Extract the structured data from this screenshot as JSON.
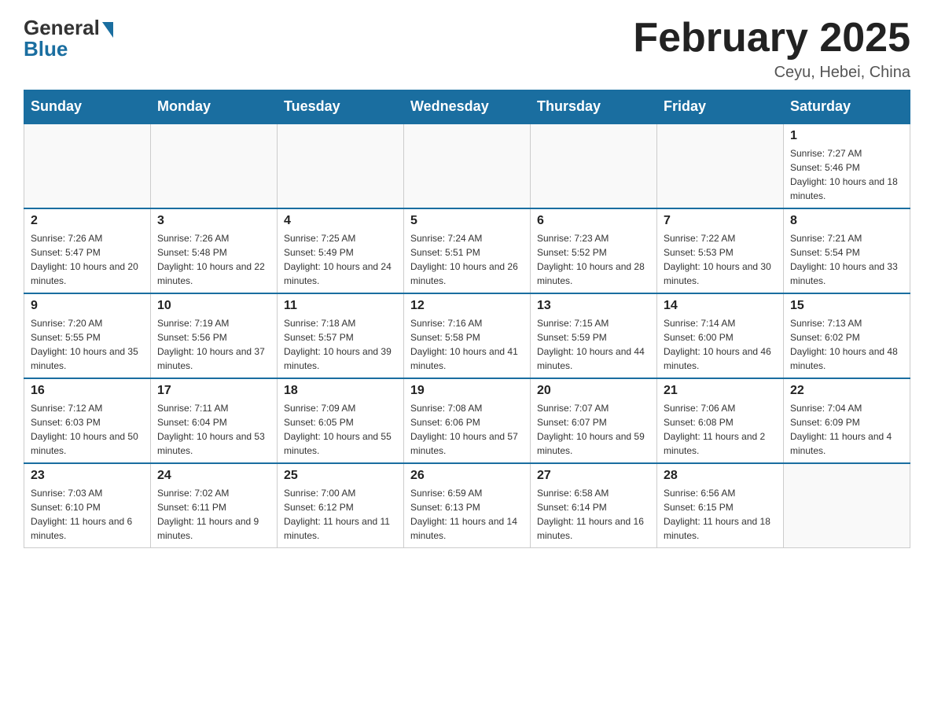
{
  "logo": {
    "general": "General",
    "blue": "Blue"
  },
  "header": {
    "month_title": "February 2025",
    "location": "Ceyu, Hebei, China"
  },
  "days_of_week": [
    "Sunday",
    "Monday",
    "Tuesday",
    "Wednesday",
    "Thursday",
    "Friday",
    "Saturday"
  ],
  "weeks": [
    [
      {
        "day": "",
        "info": ""
      },
      {
        "day": "",
        "info": ""
      },
      {
        "day": "",
        "info": ""
      },
      {
        "day": "",
        "info": ""
      },
      {
        "day": "",
        "info": ""
      },
      {
        "day": "",
        "info": ""
      },
      {
        "day": "1",
        "info": "Sunrise: 7:27 AM\nSunset: 5:46 PM\nDaylight: 10 hours and 18 minutes."
      }
    ],
    [
      {
        "day": "2",
        "info": "Sunrise: 7:26 AM\nSunset: 5:47 PM\nDaylight: 10 hours and 20 minutes."
      },
      {
        "day": "3",
        "info": "Sunrise: 7:26 AM\nSunset: 5:48 PM\nDaylight: 10 hours and 22 minutes."
      },
      {
        "day": "4",
        "info": "Sunrise: 7:25 AM\nSunset: 5:49 PM\nDaylight: 10 hours and 24 minutes."
      },
      {
        "day": "5",
        "info": "Sunrise: 7:24 AM\nSunset: 5:51 PM\nDaylight: 10 hours and 26 minutes."
      },
      {
        "day": "6",
        "info": "Sunrise: 7:23 AM\nSunset: 5:52 PM\nDaylight: 10 hours and 28 minutes."
      },
      {
        "day": "7",
        "info": "Sunrise: 7:22 AM\nSunset: 5:53 PM\nDaylight: 10 hours and 30 minutes."
      },
      {
        "day": "8",
        "info": "Sunrise: 7:21 AM\nSunset: 5:54 PM\nDaylight: 10 hours and 33 minutes."
      }
    ],
    [
      {
        "day": "9",
        "info": "Sunrise: 7:20 AM\nSunset: 5:55 PM\nDaylight: 10 hours and 35 minutes."
      },
      {
        "day": "10",
        "info": "Sunrise: 7:19 AM\nSunset: 5:56 PM\nDaylight: 10 hours and 37 minutes."
      },
      {
        "day": "11",
        "info": "Sunrise: 7:18 AM\nSunset: 5:57 PM\nDaylight: 10 hours and 39 minutes."
      },
      {
        "day": "12",
        "info": "Sunrise: 7:16 AM\nSunset: 5:58 PM\nDaylight: 10 hours and 41 minutes."
      },
      {
        "day": "13",
        "info": "Sunrise: 7:15 AM\nSunset: 5:59 PM\nDaylight: 10 hours and 44 minutes."
      },
      {
        "day": "14",
        "info": "Sunrise: 7:14 AM\nSunset: 6:00 PM\nDaylight: 10 hours and 46 minutes."
      },
      {
        "day": "15",
        "info": "Sunrise: 7:13 AM\nSunset: 6:02 PM\nDaylight: 10 hours and 48 minutes."
      }
    ],
    [
      {
        "day": "16",
        "info": "Sunrise: 7:12 AM\nSunset: 6:03 PM\nDaylight: 10 hours and 50 minutes."
      },
      {
        "day": "17",
        "info": "Sunrise: 7:11 AM\nSunset: 6:04 PM\nDaylight: 10 hours and 53 minutes."
      },
      {
        "day": "18",
        "info": "Sunrise: 7:09 AM\nSunset: 6:05 PM\nDaylight: 10 hours and 55 minutes."
      },
      {
        "day": "19",
        "info": "Sunrise: 7:08 AM\nSunset: 6:06 PM\nDaylight: 10 hours and 57 minutes."
      },
      {
        "day": "20",
        "info": "Sunrise: 7:07 AM\nSunset: 6:07 PM\nDaylight: 10 hours and 59 minutes."
      },
      {
        "day": "21",
        "info": "Sunrise: 7:06 AM\nSunset: 6:08 PM\nDaylight: 11 hours and 2 minutes."
      },
      {
        "day": "22",
        "info": "Sunrise: 7:04 AM\nSunset: 6:09 PM\nDaylight: 11 hours and 4 minutes."
      }
    ],
    [
      {
        "day": "23",
        "info": "Sunrise: 7:03 AM\nSunset: 6:10 PM\nDaylight: 11 hours and 6 minutes."
      },
      {
        "day": "24",
        "info": "Sunrise: 7:02 AM\nSunset: 6:11 PM\nDaylight: 11 hours and 9 minutes."
      },
      {
        "day": "25",
        "info": "Sunrise: 7:00 AM\nSunset: 6:12 PM\nDaylight: 11 hours and 11 minutes."
      },
      {
        "day": "26",
        "info": "Sunrise: 6:59 AM\nSunset: 6:13 PM\nDaylight: 11 hours and 14 minutes."
      },
      {
        "day": "27",
        "info": "Sunrise: 6:58 AM\nSunset: 6:14 PM\nDaylight: 11 hours and 16 minutes."
      },
      {
        "day": "28",
        "info": "Sunrise: 6:56 AM\nSunset: 6:15 PM\nDaylight: 11 hours and 18 minutes."
      },
      {
        "day": "",
        "info": ""
      }
    ]
  ]
}
